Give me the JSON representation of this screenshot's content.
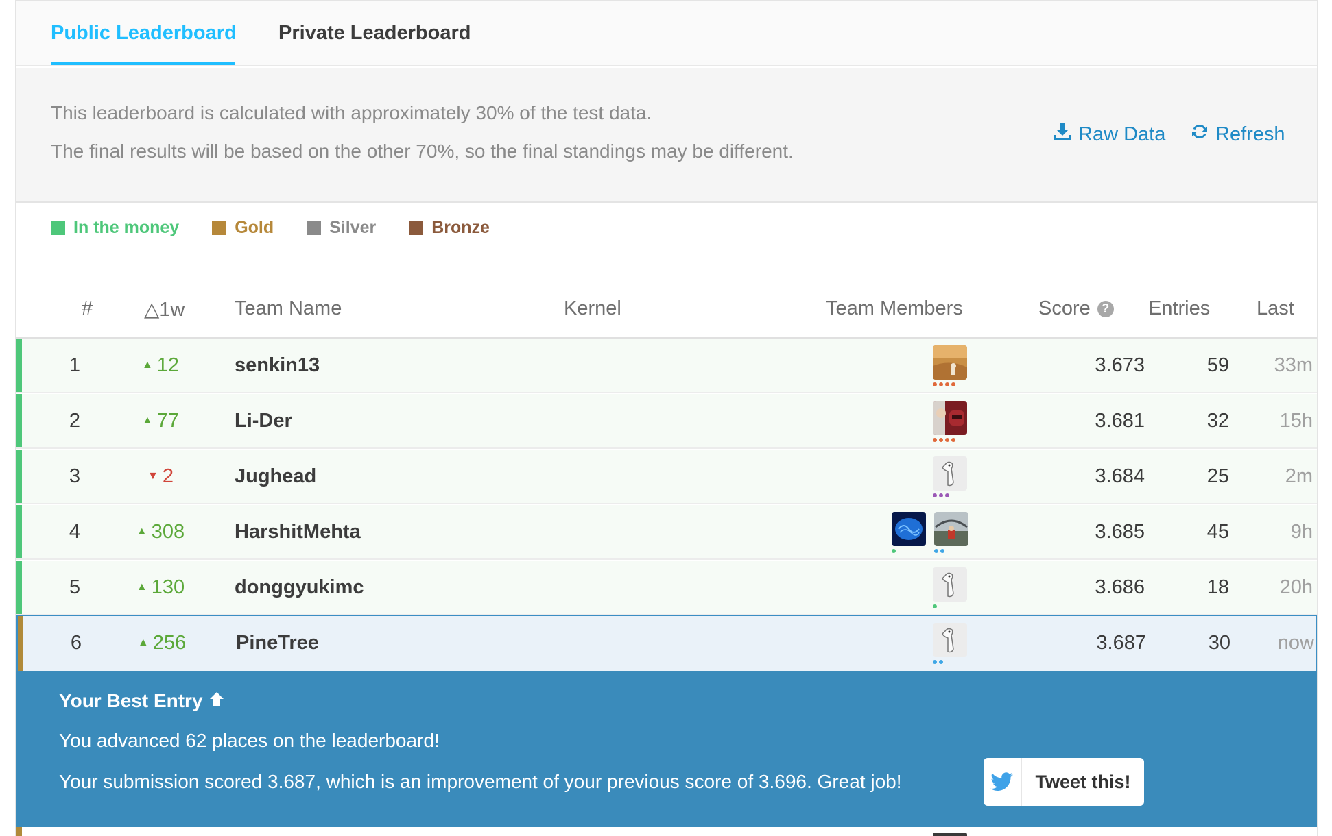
{
  "tabs": [
    {
      "label": "Public Leaderboard"
    },
    {
      "label": "Private Leaderboard"
    }
  ],
  "info": {
    "line1": "This leaderboard is calculated with approximately 30% of the test data.",
    "line2": "The final results will be based on the other 70%, so the final standings may be different.",
    "raw_data": "Raw Data",
    "refresh": "Refresh"
  },
  "legend": [
    {
      "label": "In the money",
      "color": "#4ec77a"
    },
    {
      "label": "Gold",
      "color": "#b6883a"
    },
    {
      "label": "Silver",
      "color": "#8a8a8a"
    },
    {
      "label": "Bronze",
      "color": "#8b5a3c"
    }
  ],
  "columns": {
    "rank": "#",
    "delta": "△1w",
    "team": "Team Name",
    "kernel": "Kernel",
    "members": "Team Members",
    "score": "Score",
    "entries": "Entries",
    "last": "Last"
  },
  "rows": [
    {
      "rank": "1",
      "delta": "12",
      "dir": "up",
      "team": "senkin13",
      "score": "3.673",
      "entries": "59",
      "last": "33m"
    },
    {
      "rank": "2",
      "delta": "77",
      "dir": "up",
      "team": "Li-Der",
      "score": "3.681",
      "entries": "32",
      "last": "15h"
    },
    {
      "rank": "3",
      "delta": "2",
      "dir": "down",
      "team": "Jughead",
      "score": "3.684",
      "entries": "25",
      "last": "2m"
    },
    {
      "rank": "4",
      "delta": "308",
      "dir": "up",
      "team": "HarshitMehta",
      "score": "3.685",
      "entries": "45",
      "last": "9h"
    },
    {
      "rank": "5",
      "delta": "130",
      "dir": "up",
      "team": "donggyukimc",
      "score": "3.686",
      "entries": "18",
      "last": "20h"
    },
    {
      "rank": "6",
      "delta": "256",
      "dir": "up",
      "team": "PineTree",
      "score": "3.687",
      "entries": "30",
      "last": "now"
    }
  ],
  "banner": {
    "title": "Your Best Entry",
    "line1": "You advanced 62 places on the leaderboard!",
    "line2": "Your submission scored 3.687, which is an improvement of your previous score of 3.696. Great job!",
    "tweet": "Tweet this!"
  }
}
